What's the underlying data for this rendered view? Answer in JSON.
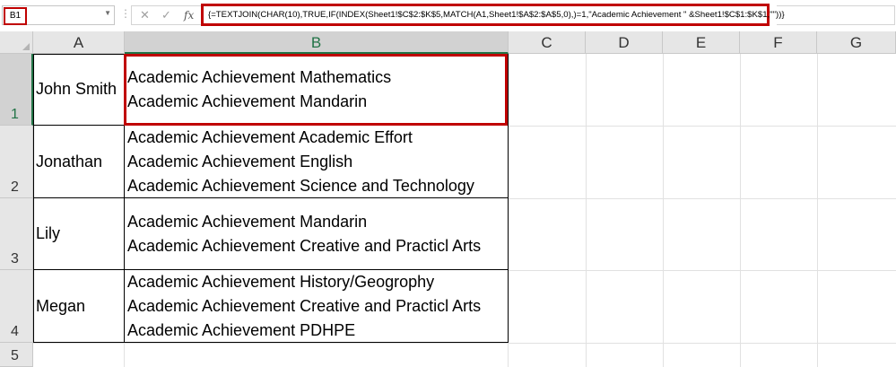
{
  "formula_bar": {
    "name_box": "B1",
    "formula": "{=TEXTJOIN(CHAR(10),TRUE,IF(INDEX(Sheet1!$C$2:$K$5,MATCH(A1,Sheet1!$A$2:$A$5,0),)=1,\"Academic Achievement \" &Sheet1!$C$1:$K$1,\"\"))}",
    "cancel_icon": "close-icon",
    "enter_icon": "checkmark-icon",
    "fx_label": "fx"
  },
  "columns": [
    "A",
    "B",
    "C",
    "D",
    "E",
    "F",
    "G"
  ],
  "rows": [
    "1",
    "2",
    "3",
    "4",
    "5"
  ],
  "cells": [
    {
      "name": "John Smith",
      "lines": [
        "Academic Achievement Mathematics",
        "Academic Achievement Mandarin"
      ]
    },
    {
      "name": "Jonathan",
      "lines": [
        "Academic Achievement Academic Effort",
        "Academic Achievement English",
        "Academic Achievement Science and Technology"
      ]
    },
    {
      "name": "Lily",
      "lines": [
        "Academic Achievement Mandarin",
        "Academic Achievement Creative and Practicl Arts"
      ]
    },
    {
      "name": "Megan",
      "lines": [
        "Academic Achievement History/Geogrophy",
        "Academic Achievement Creative and Practicl Arts",
        "Academic Achievement PDHPE"
      ]
    }
  ],
  "colors": {
    "highlight": "#c00000",
    "excel_green": "#217346"
  }
}
